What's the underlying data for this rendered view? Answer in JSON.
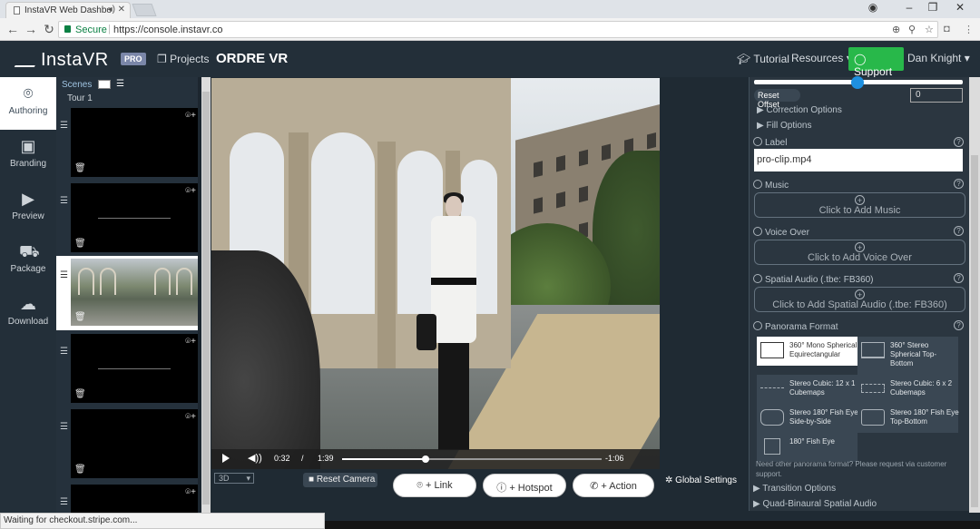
{
  "browser": {
    "tab_title": "InstaVR Web Dashbo",
    "secure_label": "Secure",
    "url": "https://console.instavr.co",
    "status_text": "Waiting for checkout.stripe.com..."
  },
  "header": {
    "logo_text": "InstaVR",
    "pro_badge": "PRO",
    "projects_label": "Projects",
    "project_title": "ORDRE VR",
    "tutorial_label": "Tutorial",
    "resources_label": "Resources",
    "support_label": "Support",
    "user_name": "Dan Knight"
  },
  "sidebar": {
    "items": [
      {
        "label": "Authoring",
        "icon": "map-pin-icon",
        "active": true
      },
      {
        "label": "Branding",
        "icon": "image-icon"
      },
      {
        "label": "Preview",
        "icon": "play-circle-icon"
      },
      {
        "label": "Package",
        "icon": "truck-icon"
      },
      {
        "label": "Download",
        "icon": "cloud-download-icon"
      }
    ]
  },
  "scenes": {
    "header": "Scenes",
    "tour_name": "Tour 1"
  },
  "viewer": {
    "current_time": "0:32",
    "separator": "/",
    "duration": "1:39",
    "remaining": "-1:06",
    "progress": 0.32,
    "mode": "3D",
    "reset_camera": "Reset Camera",
    "link_btn": "+ Link",
    "hotspot_btn": "+ Hotspot",
    "action_btn": "+ Action",
    "global_settings": "Global Settings"
  },
  "panel": {
    "reset_offset": "Reset Offset",
    "offset_value": "0",
    "correction_options": "Correction Options",
    "fill_options": "Fill Options",
    "label_heading": "Label",
    "label_value": "pro-clip.mp4",
    "music_heading": "Music",
    "music_btn": "Click to Add Music",
    "voice_heading": "Voice Over",
    "voice_btn": "Click to Add Voice Over",
    "spatial_heading": "Spatial Audio (.tbe: FB360)",
    "spatial_btn": "Click to Add Spatial Audio (.tbe: FB360)",
    "format_heading": "Panorama Format",
    "formats": [
      "360° Mono Spherical Equirectangular",
      "360° Stereo Spherical Top-Bottom",
      "Stereo Cubic: 12 x 1 Cubemaps",
      "Stereo Cubic: 6 x 2 Cubemaps",
      "Stereo 180° Fish Eye Side-by-Side",
      "Stereo 180° Fish Eye Top-Bottom",
      "180° Fish Eye"
    ],
    "format_note": "Need other panorama format? Please request via customer support.",
    "transition_options": "Transition Options",
    "quad_binaural": "Quad-Binaural Spatial Audio"
  },
  "colors": {
    "support_green": "#28b84a",
    "nav_bg": "#232f39",
    "accent_blue": "#1e90e0"
  }
}
